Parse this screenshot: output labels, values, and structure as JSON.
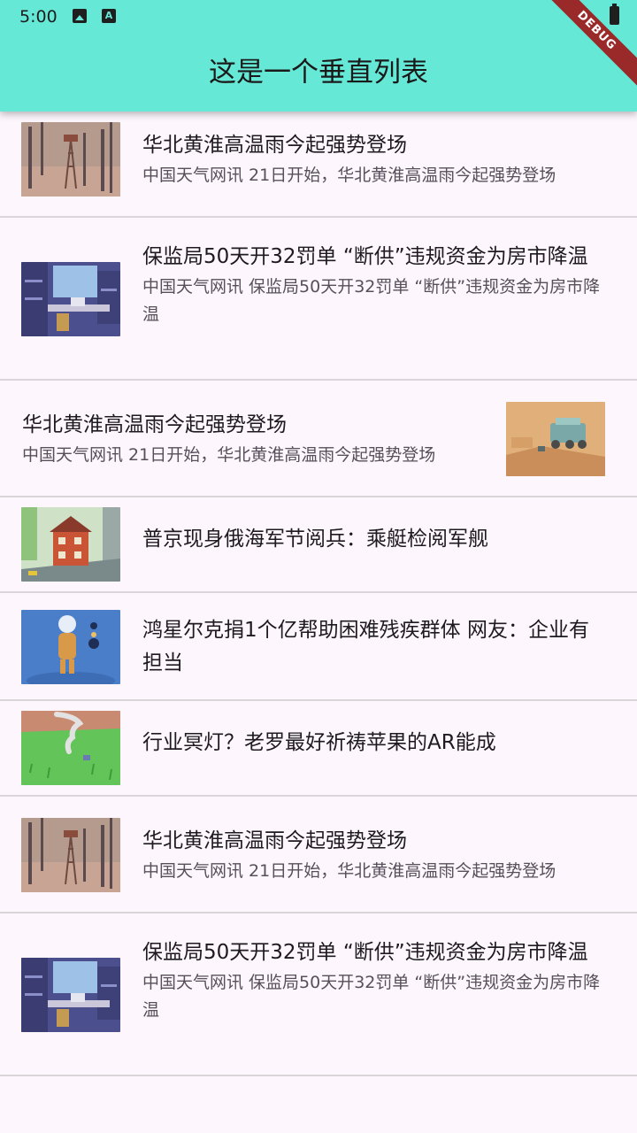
{
  "status": {
    "time": "5:00"
  },
  "appbar": {
    "title": "这是一个垂直列表",
    "debug_label": "DEBUG"
  },
  "colors": {
    "appbar": "#66e8d7",
    "background": "#fdf7fd",
    "divider": "#d9d5d9"
  },
  "items": [
    {
      "title": "华北黄淮高温雨今起强势登场",
      "subtitle": "中国天气网讯 21日开始，华北黄淮高温雨今起强势登场",
      "image": "forest-tower-illustration"
    },
    {
      "title": "保监局50天开32罚单 “断供”违规资金为房市降温",
      "subtitle": "中国天气网讯 保监局50天开32罚单 “断供”违规资金为房市降温",
      "image": "desk-room-illustration"
    },
    {
      "title": "华北黄淮高温雨今起强势登场",
      "subtitle": "中国天气网讯 21日开始，华北黄淮高温雨今起强势登场",
      "image": "rover-desert-illustration"
    },
    {
      "title": "普京现身俄海军节阅兵：乘艇检阅军舰",
      "image": "red-house-illustration"
    },
    {
      "title": "鸿星尔克捐1个亿帮助困难残疾群体 网友：企业有担当",
      "image": "astronaut-illustration"
    },
    {
      "title": "行业冥灯？老罗最好祈祷苹果的AR能成",
      "image": "tornado-grass-illustration"
    },
    {
      "title": "华北黄淮高温雨今起强势登场",
      "subtitle": "中国天气网讯 21日开始，华北黄淮高温雨今起强势登场",
      "image": "forest-tower-illustration"
    },
    {
      "title": "保监局50天开32罚单 “断供”违规资金为房市降温",
      "subtitle": "中国天气网讯 保监局50天开32罚单 “断供”违规资金为房市降温",
      "image": "desk-room-illustration"
    }
  ]
}
